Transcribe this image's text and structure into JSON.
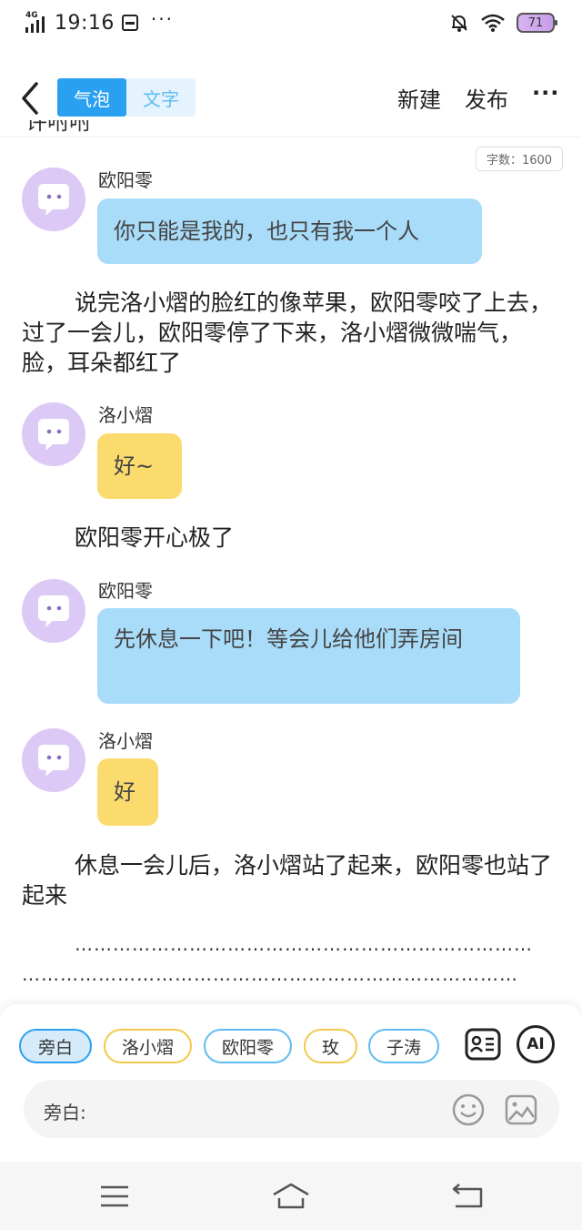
{
  "status_bar": {
    "network": "4G",
    "time": "19:16",
    "more": "···",
    "battery": "71"
  },
  "header": {
    "tab_bubble": "气泡",
    "tab_text": "文字",
    "new_label": "新建",
    "publish_label": "发布",
    "more_label": "···"
  },
  "cut_text": "许咐咐",
  "word_count": "字数：1600",
  "messages": [
    {
      "name": "欧阳零",
      "text": "你只能是我的，也只有我一个人"
    },
    {
      "name": "洛小熠",
      "text": "好~"
    },
    {
      "name": "欧阳零",
      "text": "先休息一下吧！等会儿给他们弄房间"
    },
    {
      "name": "洛小熠",
      "text": "好"
    }
  ],
  "narration": [
    "说完洛小熠的脸红的像苹果，欧阳零咬了上去，过了一会儿，欧阳零停了下来，洛小熠微微喘气，脸，耳朵都红了",
    "欧阳零开心极了",
    "休息一会儿后，洛小熠站了起来，欧阳零也站了起来"
  ],
  "dots_line1": "………………………………………………………………",
  "dots_line2": "……………………………………………………………………",
  "characters": [
    "旁白",
    "洛小熠",
    "欧阳零",
    "玫",
    "子涛"
  ],
  "input_label": "旁白:",
  "tools": {
    "profile": "profile-card-icon",
    "ai": "AI"
  },
  "colors": {
    "accent": "#2aa0f0",
    "blue_bubble": "#a9dcf9",
    "yellow_bubble": "#fbdb6e",
    "avatar": "#ddc9f5"
  }
}
